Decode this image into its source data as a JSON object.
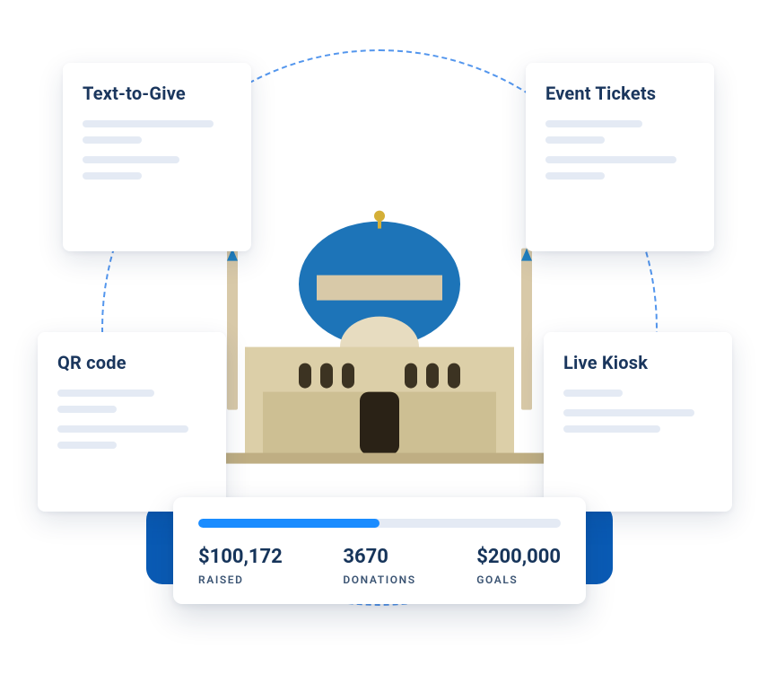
{
  "cards": {
    "text_to_give": {
      "title": "Text-to-Give"
    },
    "event_tickets": {
      "title": "Event Tickets"
    },
    "qr_code": {
      "title": "QR code"
    },
    "live_kiosk": {
      "title": "Live Kiosk"
    }
  },
  "stats": {
    "progress_percent": 50,
    "raised": {
      "value": "$100,172",
      "label": "RAISED"
    },
    "donations": {
      "value": "3670",
      "label": "DONATIONS"
    },
    "goals": {
      "value": "$200,000",
      "label": "GOALS"
    }
  }
}
